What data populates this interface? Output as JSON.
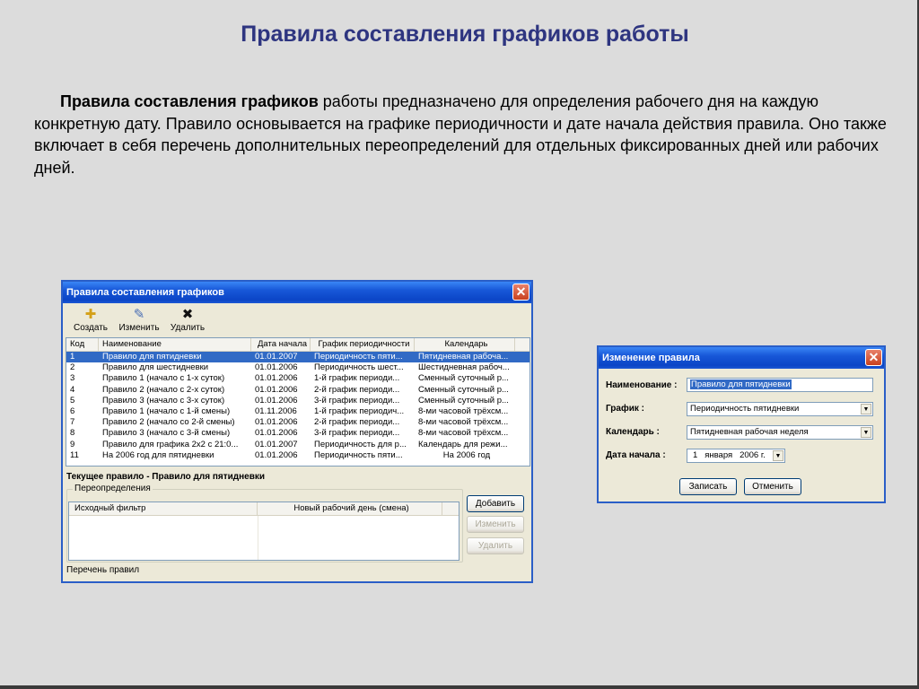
{
  "slide": {
    "title": "Правила составления графиков работы",
    "para_bold": "Правила составления графиков",
    "para_rest": " работы предназначено для определения рабочего дня на каждую конкретную дату. Правило основывается на графике периодичности и дате начала действия правила. Оно также включает в себя перечень дополнительных переопределений для отдельных фиксированных дней или рабочих дней."
  },
  "main_window": {
    "title": "Правила составления графиков",
    "close": "✕",
    "toolbar": {
      "create_label": "Создать",
      "create_icon": "✚",
      "edit_label": "Изменить",
      "edit_icon": "✎",
      "delete_label": "Удалить",
      "delete_icon": "✖"
    },
    "columns": [
      "Код",
      "Наименование",
      "Дата начала",
      "График периодичности",
      "Календарь"
    ],
    "rows": [
      [
        "1",
        "Правило для пятидневки",
        "01.01.2007",
        "Периодичность пяти...",
        "Пятидневная рабоча..."
      ],
      [
        "2",
        "Правило для шестидневки",
        "01.01.2006",
        "Периодичность шест...",
        "Шестидневная рабоч..."
      ],
      [
        "3",
        "Правило 1 (начало с 1-х суток)",
        "01.01.2006",
        "1-й график периоди...",
        "Сменный суточный р..."
      ],
      [
        "4",
        "Правило 2 (начало с 2-х суток)",
        "01.01.2006",
        "2-й график периоди...",
        "Сменный суточный р..."
      ],
      [
        "5",
        "Правило 3 (начало с 3-х суток)",
        "01.01.2006",
        "3-й график периоди...",
        "Сменный суточный р..."
      ],
      [
        "6",
        "Правило 1 (начало с 1-й смены)",
        "01.11.2006",
        "1-й график периодич...",
        "8-ми часовой трёхсм..."
      ],
      [
        "7",
        "Правило 2 (начало со 2-й смены)",
        "01.01.2006",
        "2-й график периоди...",
        "8-ми часовой трёхсм..."
      ],
      [
        "8",
        "Правило 3 (начало с 3-й смены)",
        "01.01.2006",
        "3-й график периоди...",
        "8-ми часовой трёхсм..."
      ],
      [
        "9",
        "Правило для графика 2х2 с 21:0...",
        "01.01.2007",
        "Периодичность для р...",
        "Календарь для режи..."
      ],
      [
        "11",
        "На 2006 год для пятидневки",
        "01.01.2006",
        "Периодичность пяти...",
        "На 2006 год"
      ]
    ],
    "selected_row": 0,
    "current_rule": "Текущее правило - Правило для пятидневки",
    "overrides_group": "Переопределения",
    "override_columns": [
      "Исходный фильтр",
      "Новый рабочий день (смена)"
    ],
    "add_button": "Добавить",
    "edit_button": "Изменить",
    "delete_button": "Удалить",
    "status": "Перечень правил"
  },
  "edit_dialog": {
    "title": "Изменение правила",
    "close": "✕",
    "name_label": "Наименование :",
    "name_value": "Правило для пятидневки",
    "schedule_label": "График :",
    "schedule_value": "Периодичность пятидневки",
    "calendar_label": "Календарь :",
    "calendar_value": "Пятидневная рабочая неделя",
    "start_label": "Дата начала :",
    "start_day": "1",
    "start_month": "января",
    "start_year": "2006 г.",
    "save_button": "Записать",
    "cancel_button": "Отменить",
    "arrow": "▼"
  }
}
